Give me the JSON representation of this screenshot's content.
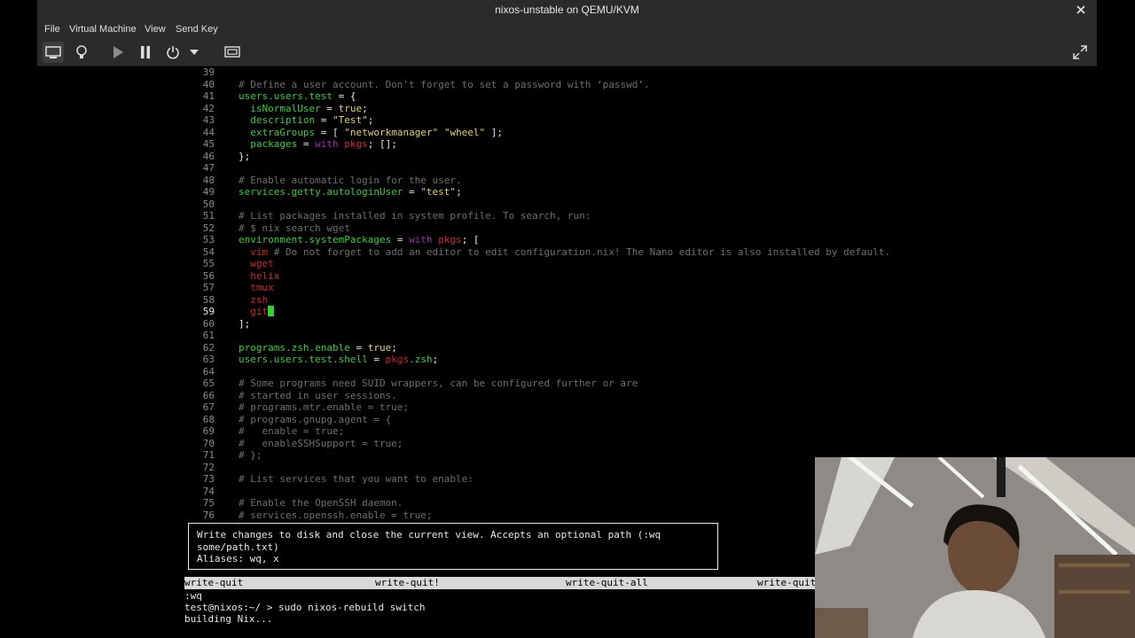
{
  "window": {
    "title": "nixos-unstable on QEMU/KVM",
    "menu": [
      "File",
      "Virtual Machine",
      "View",
      "Send Key"
    ]
  },
  "toolbar": {
    "icons": [
      "monitor-icon",
      "lightbulb-icon",
      "play-icon",
      "pause-icon",
      "power-icon",
      "dropdown-arrow-icon",
      "screen-icon",
      "fullscreen-icon"
    ]
  },
  "editor": {
    "current_line": "59",
    "lines": [
      {
        "n": "39",
        "segs": []
      },
      {
        "n": "40",
        "segs": [
          {
            "c": "c",
            "t": "# Define a user account. Don't forget to set a password with ‘passwd’."
          }
        ]
      },
      {
        "n": "41",
        "segs": [
          {
            "c": "g",
            "t": "users.users.test"
          },
          {
            "c": "w",
            "t": " = {"
          }
        ]
      },
      {
        "n": "42",
        "segs": [
          {
            "c": "w",
            "t": "  "
          },
          {
            "c": "g",
            "t": "isNormalUser"
          },
          {
            "c": "w",
            "t": " = "
          },
          {
            "c": "y",
            "t": "true"
          },
          {
            "c": "w",
            "t": ";"
          }
        ]
      },
      {
        "n": "43",
        "segs": [
          {
            "c": "w",
            "t": "  "
          },
          {
            "c": "g",
            "t": "description"
          },
          {
            "c": "w",
            "t": " = "
          },
          {
            "c": "y",
            "t": "\"Test\""
          },
          {
            "c": "w",
            "t": ";"
          }
        ]
      },
      {
        "n": "44",
        "segs": [
          {
            "c": "w",
            "t": "  "
          },
          {
            "c": "g",
            "t": "extraGroups"
          },
          {
            "c": "w",
            "t": " = [ "
          },
          {
            "c": "y",
            "t": "\"networkmanager\" \"wheel\""
          },
          {
            "c": "w",
            "t": " ];"
          }
        ]
      },
      {
        "n": "45",
        "segs": [
          {
            "c": "w",
            "t": "  "
          },
          {
            "c": "g",
            "t": "packages"
          },
          {
            "c": "w",
            "t": " = "
          },
          {
            "c": "p",
            "t": "with"
          },
          {
            "c": "w",
            "t": " "
          },
          {
            "c": "r",
            "t": "pkgs"
          },
          {
            "c": "w",
            "t": "; [];"
          }
        ]
      },
      {
        "n": "46",
        "segs": [
          {
            "c": "w",
            "t": "};"
          }
        ]
      },
      {
        "n": "47",
        "segs": []
      },
      {
        "n": "48",
        "segs": [
          {
            "c": "c",
            "t": "# Enable automatic login for the user."
          }
        ]
      },
      {
        "n": "49",
        "segs": [
          {
            "c": "g",
            "t": "services.getty.autologinUser"
          },
          {
            "c": "w",
            "t": " = "
          },
          {
            "c": "y",
            "t": "\"test\""
          },
          {
            "c": "w",
            "t": ";"
          }
        ]
      },
      {
        "n": "50",
        "segs": []
      },
      {
        "n": "51",
        "segs": [
          {
            "c": "c",
            "t": "# List packages installed in system profile. To search, run:"
          }
        ]
      },
      {
        "n": "52",
        "segs": [
          {
            "c": "c",
            "t": "# $ nix search wget"
          }
        ]
      },
      {
        "n": "53",
        "segs": [
          {
            "c": "g",
            "t": "environment.systemPackages"
          },
          {
            "c": "w",
            "t": " = "
          },
          {
            "c": "p",
            "t": "with"
          },
          {
            "c": "w",
            "t": " "
          },
          {
            "c": "r",
            "t": "pkgs"
          },
          {
            "c": "w",
            "t": "; ["
          }
        ]
      },
      {
        "n": "54",
        "segs": [
          {
            "c": "w",
            "t": "  "
          },
          {
            "c": "r",
            "t": "vim"
          },
          {
            "c": "w",
            "t": " "
          },
          {
            "c": "c",
            "t": "# Do not forget to add an editor to edit configuration.nix! The Nano editor is also installed by default."
          }
        ]
      },
      {
        "n": "55",
        "segs": [
          {
            "c": "w",
            "t": "  "
          },
          {
            "c": "r",
            "t": "wget"
          }
        ]
      },
      {
        "n": "56",
        "segs": [
          {
            "c": "w",
            "t": "  "
          },
          {
            "c": "r",
            "t": "helix"
          }
        ]
      },
      {
        "n": "57",
        "segs": [
          {
            "c": "w",
            "t": "  "
          },
          {
            "c": "r",
            "t": "tmux"
          }
        ]
      },
      {
        "n": "58",
        "segs": [
          {
            "c": "w",
            "t": "  "
          },
          {
            "c": "r",
            "t": "zsh"
          }
        ]
      },
      {
        "n": "59",
        "segs": [
          {
            "c": "w",
            "t": "  "
          },
          {
            "c": "r",
            "t": "git"
          }
        ],
        "cursor": true
      },
      {
        "n": "60",
        "segs": [
          {
            "c": "w",
            "t": "];"
          }
        ]
      },
      {
        "n": "61",
        "segs": []
      },
      {
        "n": "62",
        "segs": [
          {
            "c": "g",
            "t": "programs.zsh.enable"
          },
          {
            "c": "w",
            "t": " = "
          },
          {
            "c": "y",
            "t": "true"
          },
          {
            "c": "w",
            "t": ";"
          }
        ]
      },
      {
        "n": "63",
        "segs": [
          {
            "c": "g",
            "t": "users.users.test.shell"
          },
          {
            "c": "w",
            "t": " = "
          },
          {
            "c": "r",
            "t": "pkgs"
          },
          {
            "c": "g",
            "t": ".zsh"
          },
          {
            "c": "w",
            "t": ";"
          }
        ]
      },
      {
        "n": "64",
        "segs": []
      },
      {
        "n": "65",
        "segs": [
          {
            "c": "c",
            "t": "# Some programs need SUID wrappers, can be configured further or are"
          }
        ]
      },
      {
        "n": "66",
        "segs": [
          {
            "c": "c",
            "t": "# started in user sessions."
          }
        ]
      },
      {
        "n": "67",
        "segs": [
          {
            "c": "c",
            "t": "# programs.mtr.enable = true;"
          }
        ]
      },
      {
        "n": "68",
        "segs": [
          {
            "c": "c",
            "t": "# programs.gnupg.agent = {"
          }
        ]
      },
      {
        "n": "69",
        "segs": [
          {
            "c": "c",
            "t": "#   enable = true;"
          }
        ]
      },
      {
        "n": "70",
        "segs": [
          {
            "c": "c",
            "t": "#   enableSSHSupport = true;"
          }
        ]
      },
      {
        "n": "71",
        "segs": [
          {
            "c": "c",
            "t": "# };"
          }
        ]
      },
      {
        "n": "72",
        "segs": []
      },
      {
        "n": "73",
        "segs": [
          {
            "c": "c",
            "t": "# List services that you want to enable:"
          }
        ]
      },
      {
        "n": "74",
        "segs": []
      },
      {
        "n": "75",
        "segs": [
          {
            "c": "c",
            "t": "# Enable the OpenSSH daemon."
          }
        ]
      },
      {
        "n": "76",
        "segs": [
          {
            "c": "c",
            "t": "# services.openssh.enable = true;"
          }
        ]
      }
    ]
  },
  "help_popup": {
    "line1": "Write changes to disk and close the current view. Accepts an optional path (:wq",
    "line2": "some/path.txt)",
    "line3": "Aliases: wq, x"
  },
  "completion": [
    "write-quit",
    "write-quit!",
    "write-quit-all",
    "write-quit"
  ],
  "command_line": ":wq",
  "shell": {
    "prompt": "test@nixos:~/ > sudo nixos-rebuild switch",
    "output": "building Nix..."
  },
  "colors": {
    "comment": "#6f6f6f",
    "attribute": "#2fd22f",
    "string": "#e8d35a",
    "keyword": "#a22cb0",
    "identifier": "#d42424"
  }
}
